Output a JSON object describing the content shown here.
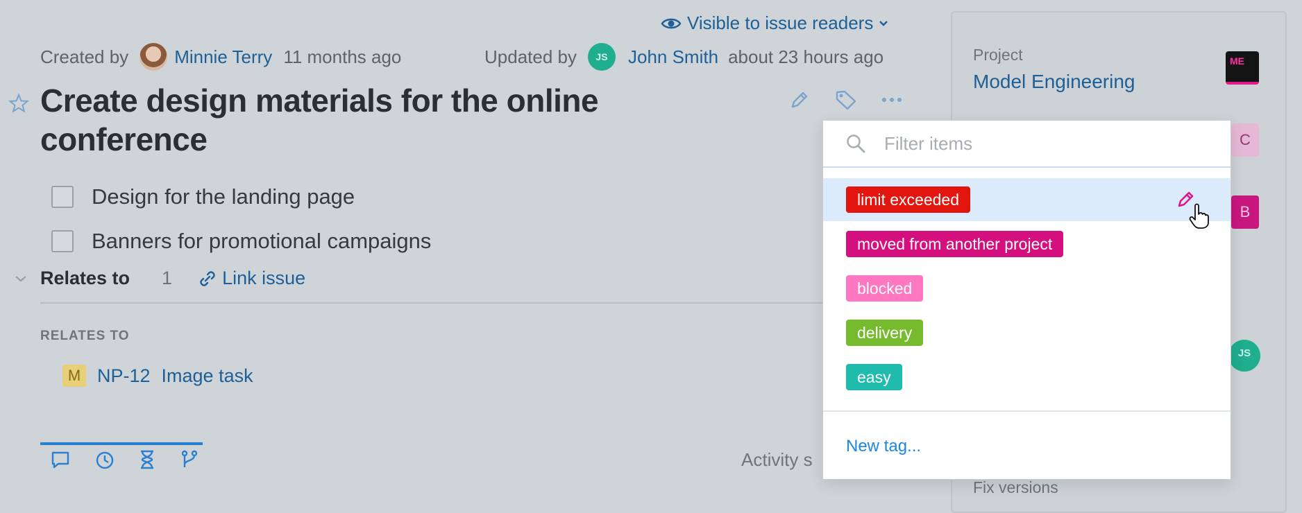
{
  "visibility": {
    "label": "Visible to issue readers"
  },
  "meta": {
    "created_label": "Created by",
    "created_user": "Minnie Terry",
    "created_time": "11 months ago",
    "updated_label": "Updated by",
    "updated_user_initials": "JS",
    "updated_user": "John Smith",
    "updated_time": "about 23 hours ago"
  },
  "issue": {
    "title": "Create design materials for the online conference",
    "checklist": [
      {
        "label": "Design for the landing page",
        "checked": false
      },
      {
        "label": "Banners for promotional campaigns",
        "checked": false
      }
    ]
  },
  "relates": {
    "header": "Relates to",
    "count": "1",
    "link_label": "Link issue",
    "section_label": "RELATES TO",
    "items": [
      {
        "badge": "M",
        "id": "NP-12",
        "name": "Image task"
      }
    ]
  },
  "activity": {
    "label": "Activity s"
  },
  "sidebar": {
    "project_label": "Project",
    "project_name": "Model Engineering",
    "project_badge": "ME",
    "badge_c": "C",
    "badge_b": "B",
    "avatar_initials": "JS",
    "fix_versions_label": "Fix versions"
  },
  "tag_dropdown": {
    "filter_placeholder": "Filter items",
    "tags": [
      {
        "label": "limit exceeded",
        "color": "#e3150f",
        "hovered": true
      },
      {
        "label": "moved from another project",
        "color": "#d4107f",
        "hovered": false
      },
      {
        "label": "blocked",
        "color": "#ff77c0",
        "hovered": false
      },
      {
        "label": "delivery",
        "color": "#76bb2e",
        "hovered": false
      },
      {
        "label": "easy",
        "color": "#1fbcae",
        "hovered": false
      }
    ],
    "new_tag_label": "New tag..."
  },
  "colors": {
    "link": "#1d5f96",
    "accent_blue": "#2a7fd0",
    "hover_row": "#dcebfb"
  },
  "icons": [
    "eye-icon",
    "chevron-down-icon",
    "star-icon",
    "pencil-icon",
    "tag-icon",
    "more-icon",
    "chevron-down-icon",
    "link-icon",
    "search-icon",
    "comment-icon",
    "history-icon",
    "hourglass-icon",
    "branch-icon",
    "cursor-hand-icon"
  ]
}
